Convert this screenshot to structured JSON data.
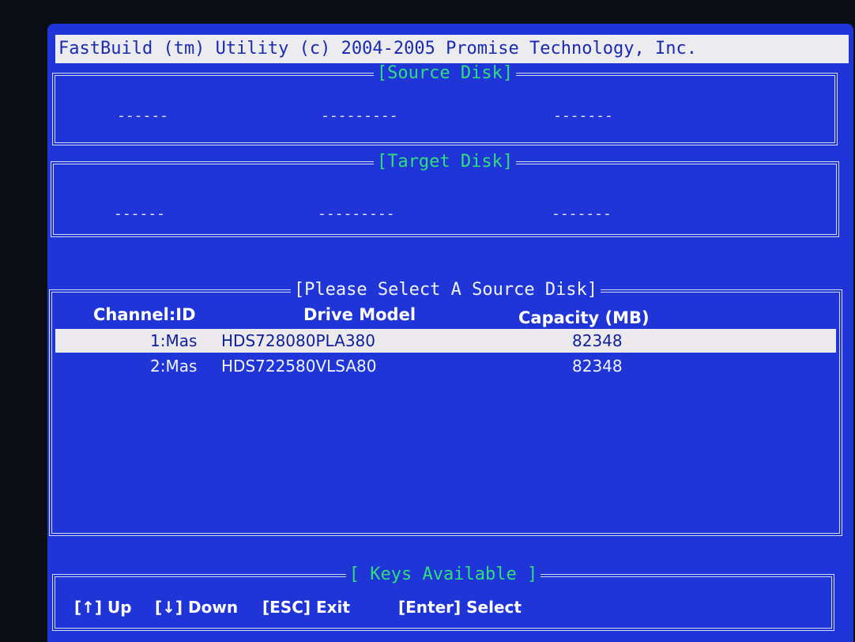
{
  "app": {
    "title": "FastBuild (tm) Utility (c) 2004-2005 Promise Technology, Inc."
  },
  "source_disk": {
    "title": "[Source Disk]",
    "channel": "------",
    "model": "---------",
    "capacity": "-------"
  },
  "target_disk": {
    "title": "[Target Disk]",
    "channel": "------",
    "model": "---------",
    "capacity": "-------"
  },
  "select_panel": {
    "title": "[Please Select A Source Disk]",
    "columns": [
      "Channel:ID",
      "Drive Model",
      "Capacity (MB)"
    ],
    "rows": [
      {
        "channel": "1:Mas",
        "model": "HDS728080PLA380",
        "capacity": "82348",
        "selected": true
      },
      {
        "channel": "2:Mas",
        "model": "HDS722580VLSA80",
        "capacity": "82348",
        "selected": false
      }
    ]
  },
  "keys_panel": {
    "title": "[ Keys Available ]",
    "keys": [
      "[↑] Up",
      "[↓] Down",
      "[ESC] Exit",
      "[Enter] Select"
    ]
  },
  "colors": {
    "screen_bg": "#1f35d8",
    "title_text": "#2fe07a",
    "highlight_bg": "#ebe9ec"
  }
}
